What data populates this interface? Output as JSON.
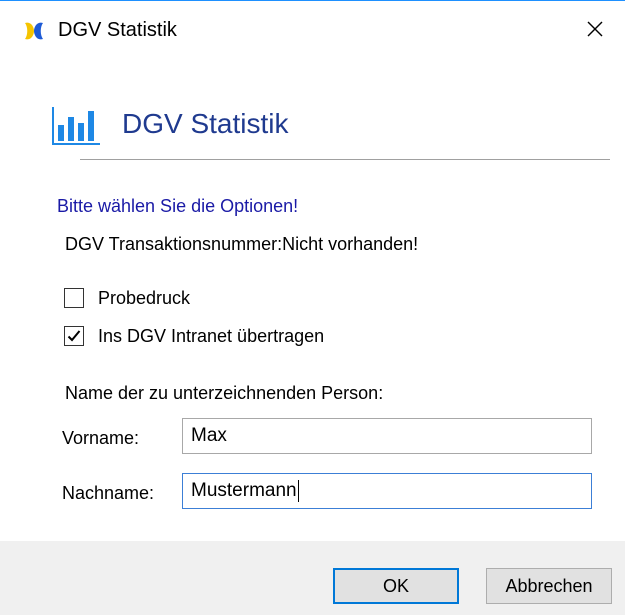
{
  "window": {
    "title": "DGV Statistik",
    "close_glyph": "✕"
  },
  "header": {
    "title": "DGV Statistik",
    "icon": "bar-chart-icon"
  },
  "form": {
    "instruction": "Bitte wählen Sie die Optionen!",
    "transaction_label": "DGV Transaktionsnummer:",
    "transaction_value": "Nicht vorhanden!",
    "checkboxes": [
      {
        "label": "Probedruck",
        "checked": false
      },
      {
        "label": "Ins DGV Intranet übertragen",
        "checked": true
      }
    ],
    "signer_section_label": "Name der zu unterzeichnenden Person:",
    "first_name": {
      "label": "Vorname:",
      "value": "Max"
    },
    "last_name": {
      "label": "Nachname:",
      "value": "Mustermann"
    }
  },
  "buttons": {
    "ok_label": "OK",
    "cancel_label": "Abbrechen"
  },
  "colors": {
    "header_title": "#1f3a8f",
    "instruction": "#1a1aa6",
    "accent": "#0078d7",
    "icon_blue": "#1e88e5",
    "app_icon_yellow": "#f5c400"
  }
}
